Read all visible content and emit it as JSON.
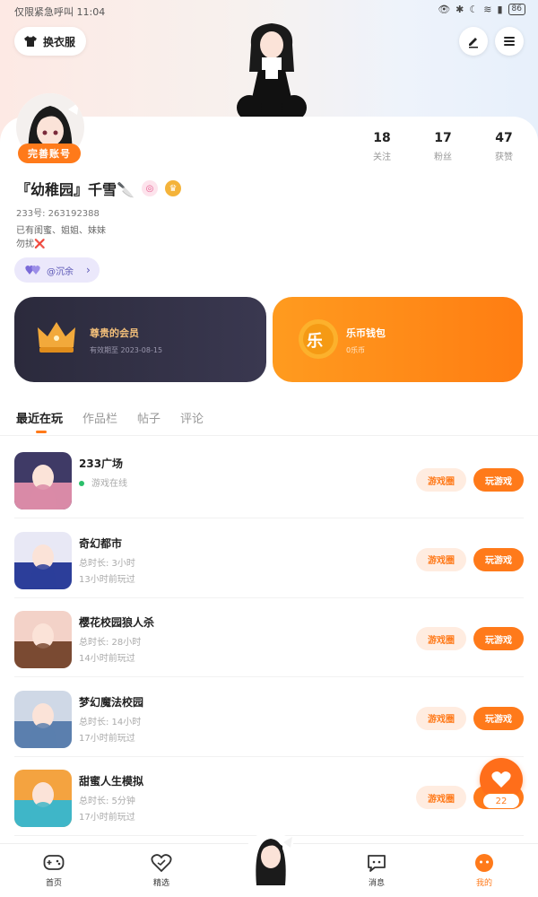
{
  "status_bar": {
    "left_text": "仅限紧急呼叫 11:04",
    "battery": "86"
  },
  "header": {
    "outfit_label": "换衣服"
  },
  "profile": {
    "badge": "完善账号",
    "stats": [
      {
        "value": "18",
        "label": "关注"
      },
      {
        "value": "17",
        "label": "粉丝"
      },
      {
        "value": "47",
        "label": "获赞"
      }
    ],
    "nickname": "『幼稚园』千雪🔪",
    "uid": "233号: 263192388",
    "bio_line1": "已有闺蜜、姐姐、妹妹",
    "bio_line2": "勿扰❌",
    "family_label": "@沉余"
  },
  "vip": {
    "title": "尊贵的会员",
    "subtitle": "有效期至 2023-08-15"
  },
  "wallet": {
    "title": "乐币钱包",
    "subtitle": "0乐币",
    "coin_glyph": "乐"
  },
  "tabs": [
    "最近在玩",
    "作品栏",
    "帖子",
    "评论"
  ],
  "games": [
    {
      "name": "233广场",
      "line1": "游戏在线",
      "line2": "",
      "online": true,
      "circle": "游戏圈",
      "play": "玩游戏",
      "color_a": "#d98aa7",
      "color_b": "#3f3a66"
    },
    {
      "name": "奇幻都市",
      "line1": "总时长: 3小时",
      "line2": "13小时前玩过",
      "online": false,
      "circle": "游戏圈",
      "play": "玩游戏",
      "color_a": "#2c3e9a",
      "color_b": "#e8e8f5"
    },
    {
      "name": "樱花校园狼人杀",
      "line1": "总时长: 28小时",
      "line2": "14小时前玩过",
      "online": false,
      "circle": "游戏圈",
      "play": "玩游戏",
      "color_a": "#7a4a32",
      "color_b": "#f3d2c8"
    },
    {
      "name": "梦幻魔法校园",
      "line1": "总时长: 14小时",
      "line2": "17小时前玩过",
      "online": false,
      "circle": "游戏圈",
      "play": "玩游戏",
      "color_a": "#5b7fae",
      "color_b": "#cfd8e6"
    },
    {
      "name": "甜蜜人生模拟",
      "line1": "总时长: 5分钟",
      "line2": "17小时前玩过",
      "online": false,
      "circle": "游戏圈",
      "play": "玩游戏",
      "color_a": "#3fb6c8",
      "color_b": "#f4a340"
    }
  ],
  "fab_count": "22",
  "bottom_nav": [
    {
      "label": "首页",
      "icon": "gamepad-icon"
    },
    {
      "label": "精选",
      "icon": "heart-outline-icon"
    },
    {
      "label": "消息",
      "icon": "message-icon"
    },
    {
      "label": "我的",
      "icon": "me-icon"
    }
  ],
  "colors": {
    "accent": "#ff7a1a",
    "vip_bg": "#2b2a3c",
    "wallet_bg": "#ff8c16"
  }
}
